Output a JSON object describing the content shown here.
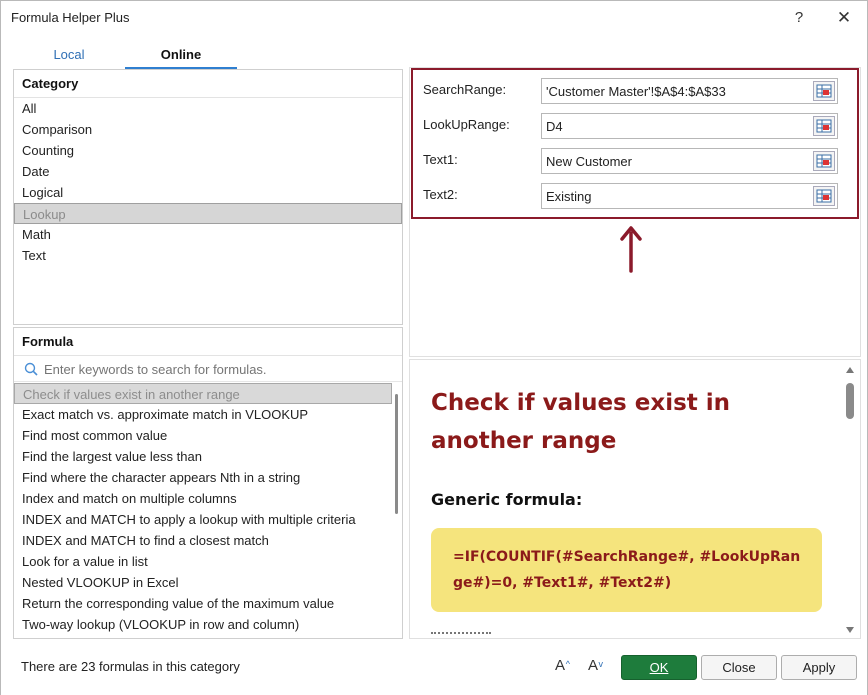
{
  "window": {
    "title": "Formula Helper Plus",
    "help": "?",
    "close": "✕"
  },
  "tabs": [
    {
      "label": "Local"
    },
    {
      "label": "Online"
    }
  ],
  "category": {
    "header": "Category",
    "items": [
      "All",
      "Comparison",
      "Counting",
      "Date",
      "Logical",
      "Lookup",
      "Math",
      "Text"
    ],
    "selected": "Lookup"
  },
  "formula": {
    "header": "Formula",
    "search_placeholder": "Enter keywords to search for formulas.",
    "items": [
      "Check if values exist in another range",
      "Exact match vs. approximate match in VLOOKUP",
      "Find most common value",
      "Find the largest value less than",
      "Find where the character appears Nth in a string",
      "Index and match on multiple columns",
      "INDEX and MATCH to apply a lookup with multiple criteria",
      "INDEX and MATCH to find a closest match",
      "Look for a value in list",
      "Nested VLOOKUP in Excel",
      "Return the corresponding value of the maximum value",
      "Two-way lookup (VLOOKUP in row and column)"
    ],
    "selected": "Check if values exist in another range"
  },
  "params": [
    {
      "label": "SearchRange:",
      "value": "'Customer Master'!$A$4:$A$33"
    },
    {
      "label": "LookUpRange:",
      "value": "D4"
    },
    {
      "label": "Text1:",
      "value": "New Customer"
    },
    {
      "label": "Text2:",
      "value": "Existing"
    }
  ],
  "description": {
    "title": "Check if values exist in another range",
    "subtitle": "Generic formula:",
    "formula": "=IF(COUNTIF(#SearchRange#, #LookUpRange#)=0, #Text1#, #Text2#)"
  },
  "footer": {
    "status": "There are 23 formulas in this category",
    "font_increase": "A",
    "font_decrease": "A",
    "ok": "OK",
    "close": "Close",
    "apply": "Apply"
  },
  "colors": {
    "accent_red": "#8b1a2b",
    "ok_green": "#1e7c3c",
    "formula_bg": "#f5e47d",
    "tab_blue": "#2f7fd0"
  }
}
